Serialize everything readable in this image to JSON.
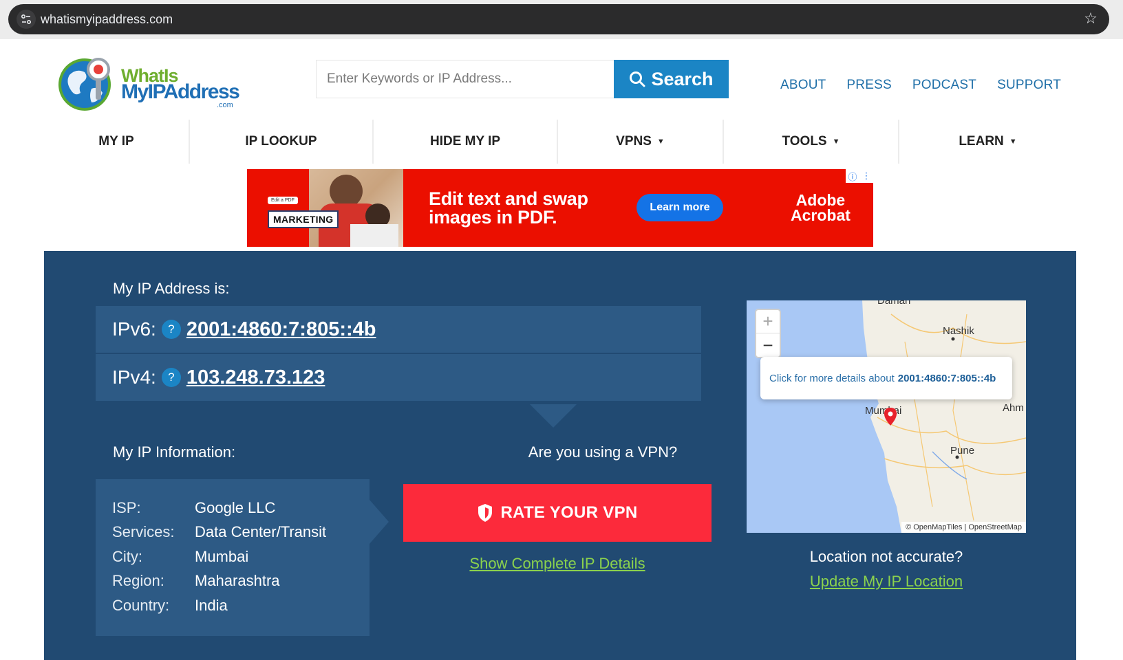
{
  "browser": {
    "url": "whatismyipaddress.com"
  },
  "logo": {
    "line1": "WhatIs",
    "line2": "MyIPAddress",
    "line3": ".com"
  },
  "search": {
    "placeholder": "Enter Keywords or IP Address...",
    "button_label": "Search"
  },
  "top_links": [
    "ABOUT",
    "PRESS",
    "PODCAST",
    "SUPPORT"
  ],
  "nav": [
    {
      "label": "MY IP"
    },
    {
      "label": "IP LOOKUP"
    },
    {
      "label": "HIDE MY IP"
    },
    {
      "label": "VPNS",
      "caret": "▼"
    },
    {
      "label": "TOOLS",
      "caret": "▼"
    },
    {
      "label": "LEARN",
      "caret": "▼"
    }
  ],
  "ad": {
    "small_tag": "Edit a PDF",
    "badge": "MARKETING",
    "headline_line1": "Edit text and swap",
    "headline_line2": "images in PDF.",
    "cta": "Learn more",
    "brand_line1": "Adobe",
    "brand_line2": "Acrobat",
    "accent": "#eb0f00"
  },
  "ip": {
    "heading": "My IP Address is:",
    "ipv6_label": "IPv6:",
    "ipv6": "2001:4860:7:805::4b",
    "ipv4_label": "IPv4:",
    "ipv4": "103.248.73.123",
    "help_glyph": "?"
  },
  "info": {
    "heading": "My IP Information:",
    "rows": [
      {
        "key": "ISP:",
        "value": "Google LLC"
      },
      {
        "key": "Services:",
        "value": "Data Center/Transit"
      },
      {
        "key": "City:",
        "value": "Mumbai"
      },
      {
        "key": "Region:",
        "value": "Maharashtra"
      },
      {
        "key": "Country:",
        "value": "India"
      }
    ]
  },
  "vpn": {
    "question": "Are you using a VPN?",
    "button_label": "RATE YOUR VPN",
    "details_link": "Show Complete IP Details"
  },
  "map": {
    "zoom_in": "+",
    "zoom_out": "−",
    "popup_prefix": "Click for more details about",
    "popup_ip": "2001:4860:7:805::4b",
    "labels": {
      "top": "Daman",
      "nashik": "Nashik",
      "mumbai": "Mumbai",
      "ahm": "Ahm",
      "pune": "Pune"
    },
    "attribution": "© OpenMapTiles | OpenStreetMap"
  },
  "location": {
    "question": "Location not accurate?",
    "update_link": "Update My IP Location"
  },
  "colors": {
    "panel": "#214a72",
    "row": "#2d5a85",
    "brand_blue": "#1b85c5",
    "vpn_red": "#fc2a3b",
    "link_green": "#8bd24d"
  }
}
